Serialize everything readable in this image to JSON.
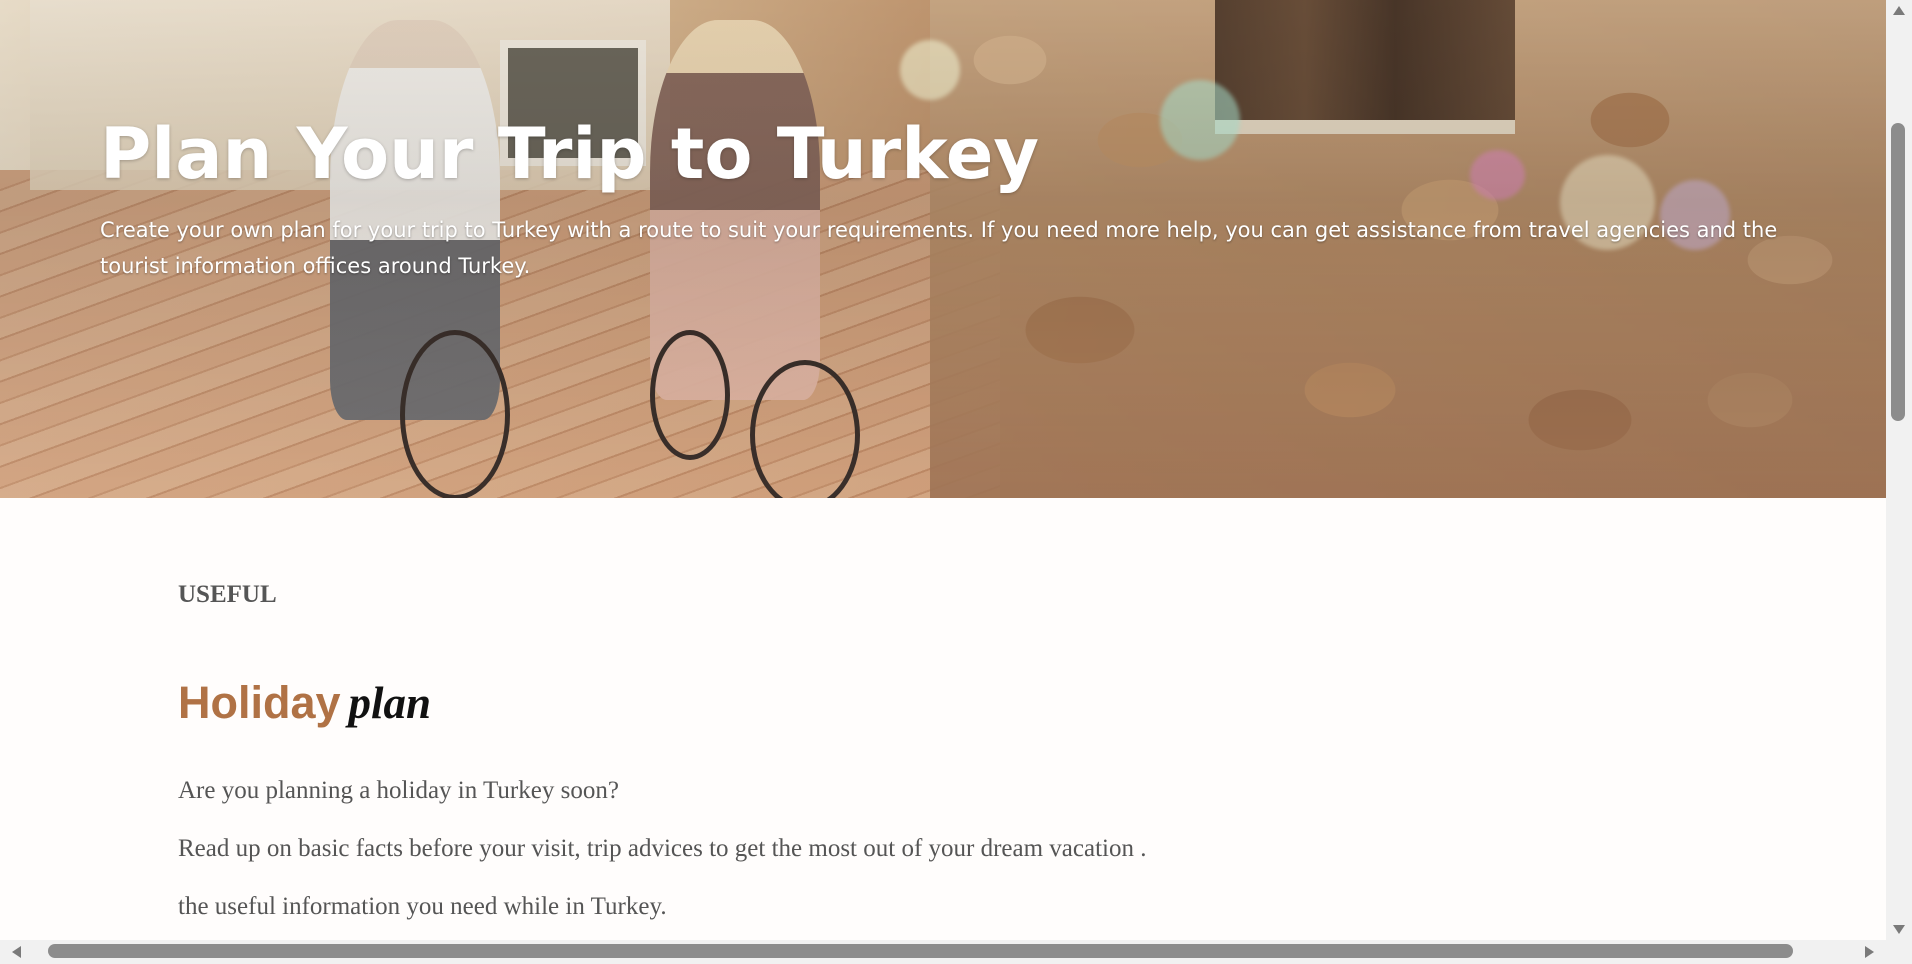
{
  "hero": {
    "title": "Plan Your Trip to Turkey",
    "subtitle": "Create your own plan for your trip to Turkey with a route to suit your requirements. If you need more help, you can get assistance from travel agencies and the tourist information offices around Turkey."
  },
  "section": {
    "eyebrow": "USEFUL",
    "heading_strong": "Holiday",
    "heading_italic": "plan",
    "paragraphs": [
      "Are you planning a holiday in Turkey soon?",
      "Read up on basic facts before your visit, trip advices to get the most out of your dream vacation .",
      "the useful information you need while in Turkey."
    ]
  },
  "colors": {
    "accent": "#b07245",
    "body_text": "#555555",
    "heading_dark": "#111111"
  },
  "icons": {
    "scroll_up": "triangle-up-icon",
    "scroll_down": "triangle-down-icon",
    "scroll_left": "triangle-left-icon",
    "scroll_right": "triangle-right-icon"
  }
}
